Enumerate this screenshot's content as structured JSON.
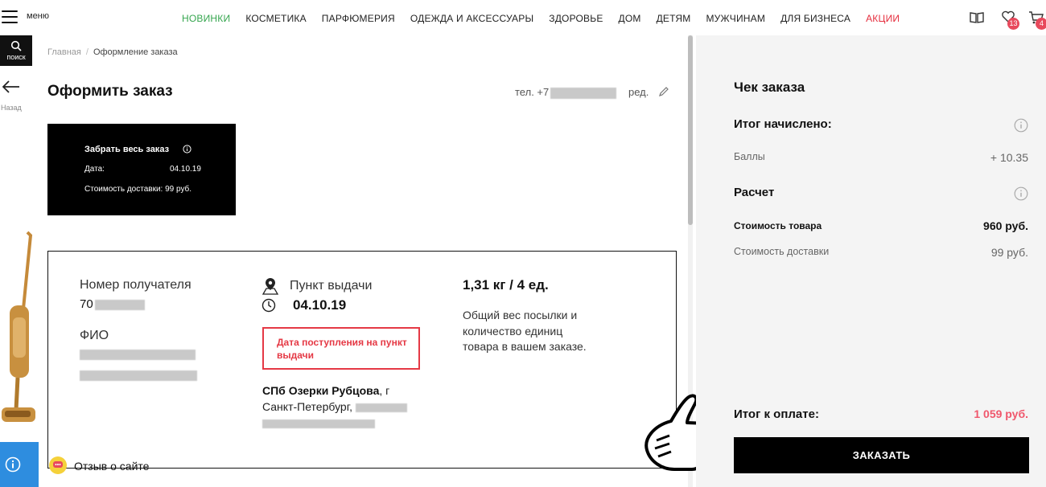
{
  "header": {
    "menu_label": "меню",
    "nav": [
      {
        "label": "НОВИНКИ",
        "color": "#36a64f"
      },
      {
        "label": "КОСМЕТИКА"
      },
      {
        "label": "ПАРФЮМЕРИЯ"
      },
      {
        "label": "ОДЕЖДА И АКСЕССУАРЫ"
      },
      {
        "label": "ЗДОРОВЬЕ"
      },
      {
        "label": "ДОМ"
      },
      {
        "label": "ДЕТЯМ"
      },
      {
        "label": "МУЖЧИНАМ"
      },
      {
        "label": "ДЛЯ БИЗНЕСА"
      },
      {
        "label": "АКЦИИ",
        "color": "#e52e3e"
      }
    ],
    "favorites_count": "13",
    "cart_count": "4",
    "icons": [
      "book-icon",
      "heart-icon",
      "cart-icon"
    ]
  },
  "sidebar": {
    "search_label": "поиск",
    "back_label": "Назад"
  },
  "breadcrumb": {
    "home": "Главная",
    "separator": "/",
    "current": "Оформление заказа"
  },
  "page": {
    "title": "Оформить заказ",
    "phone_prefix": "тел. +7",
    "edit_label": "ред."
  },
  "delivery_card": {
    "title": "Забрать весь заказ",
    "date_label": "Дата:",
    "date_value": "04.10.19",
    "cost_text": "Стоимость доставки: 99 руб."
  },
  "order": {
    "recipient_number_label": "Номер получателя",
    "recipient_number_prefix": "70",
    "fio_label": "ФИО",
    "pickup_title": "Пункт выдачи",
    "pickup_date": "04.10.19",
    "arrival_note": "Дата поступления на пункт выдачи",
    "address_name": "СПб Озерки Рубцова",
    "address_rest": ", г Санкт-Петербург,",
    "weight": "1,31 кг / 4  ед.",
    "weight_desc": "Общий вес посылки и количество единиц товара в вашем заказе."
  },
  "feedback": {
    "label": "Отзыв о сайте"
  },
  "summary": {
    "title": "Чек заказа",
    "accrued_title": "Итог начислено:",
    "points_label": "Баллы",
    "points_value": "+ 10.35",
    "calc_title": "Расчет",
    "goods_label": "Стоимость товара",
    "goods_value": "960 руб.",
    "delivery_label": "Стоимость доставки",
    "delivery_value": "99 руб.",
    "total_label": "Итог к оплате:",
    "total_value": "1 059 руб.",
    "order_button": "ЗАКАЗАТЬ",
    "accent_color": "#f0576c"
  }
}
